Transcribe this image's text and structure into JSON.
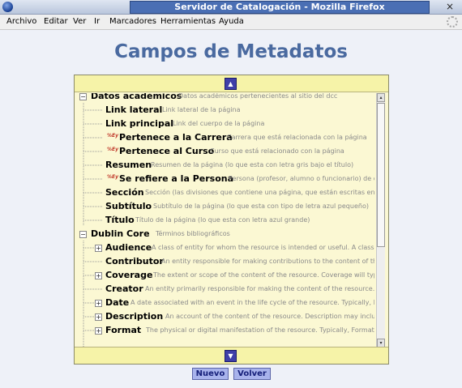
{
  "window": {
    "title": "Servidor de Catalogación - Mozilla Firefox",
    "close": "×"
  },
  "menu": [
    "Archivo",
    "Editar",
    "Ver",
    "Ir",
    "Marcadores",
    "Herramientas",
    "Ayuda"
  ],
  "page": {
    "title": "Campos de Metadatos"
  },
  "tree": [
    {
      "label": "Datos académicos",
      "desc": "Datos académicos pertenecientes al sitio del dcc",
      "toggle": "−",
      "ref": false
    },
    {
      "label": "Link lateral",
      "desc": "Link lateral de la página",
      "toggle": "",
      "ref": false
    },
    {
      "label": "Link principal",
      "desc": "Link del cuerpo de la página",
      "toggle": "",
      "ref": false
    },
    {
      "label": "Pertenece a la Carrera",
      "desc": "Carrera que está relacionada con la página",
      "toggle": "",
      "ref": true
    },
    {
      "label": "Pertenece al Curso",
      "desc": "Curso que está relacionado con la página",
      "toggle": "",
      "ref": true
    },
    {
      "label": "Resumen",
      "desc": "Resumen de la página (lo que esta con letra gris bajo el título)",
      "toggle": "",
      "ref": false
    },
    {
      "label": "Se refiere a la Persona",
      "desc": "Persona (profesor, alumno o funcionario) de q",
      "toggle": "",
      "ref": true
    },
    {
      "label": "Sección",
      "desc": "Sección (las divisiones que contiene una página, que están escritas en",
      "toggle": "",
      "ref": false
    },
    {
      "label": "Subtítulo",
      "desc": "Subtítulo de la página (lo que esta con tipo de letra azul pequeño)",
      "toggle": "",
      "ref": false
    },
    {
      "label": "Título",
      "desc": "Título de la página (lo que esta con letra azul grande)",
      "toggle": "",
      "ref": false
    },
    {
      "label": "Dublin Core",
      "desc": "Términos bibliográficos",
      "toggle": "−",
      "ref": false
    },
    {
      "label": "Audience",
      "desc": "A class of entity for whom the resource is intended or useful. A class of",
      "toggle": "+",
      "ref": false
    },
    {
      "label": "Contributor",
      "desc": "An entity responsible for making contributions to the content of the",
      "toggle": "",
      "ref": false
    },
    {
      "label": "Coverage",
      "desc": "The extent or scope of the content of the resource. Coverage will typica",
      "toggle": "+",
      "ref": false
    },
    {
      "label": "Creator",
      "desc": "An entity primarily responsible for making the content of the resource. Ex",
      "toggle": "",
      "ref": false
    },
    {
      "label": "Date",
      "desc": "A date associated with an event in the life cycle of the resource. Typically, Date",
      "toggle": "+",
      "ref": false
    },
    {
      "label": "Description",
      "desc": "An account of the content of the resource. Description may include t",
      "toggle": "+",
      "ref": false
    },
    {
      "label": "Format",
      "desc": "The physical or digital manifestation of the resource. Typically, Format ma",
      "toggle": "+",
      "ref": false
    }
  ],
  "ref_icon": "%Ey",
  "scroll": {
    "up": "▲",
    "down": "▼",
    "small_up": "▴",
    "small_down": "▾"
  },
  "buttons": {
    "new": "Nuevo",
    "back": "Volver"
  },
  "colors": {
    "title": "#4a6aa0",
    "panel_bg": "#fbf8d3",
    "panel_bar": "#f6f3a8",
    "button_bg": "#a8b3ec"
  }
}
